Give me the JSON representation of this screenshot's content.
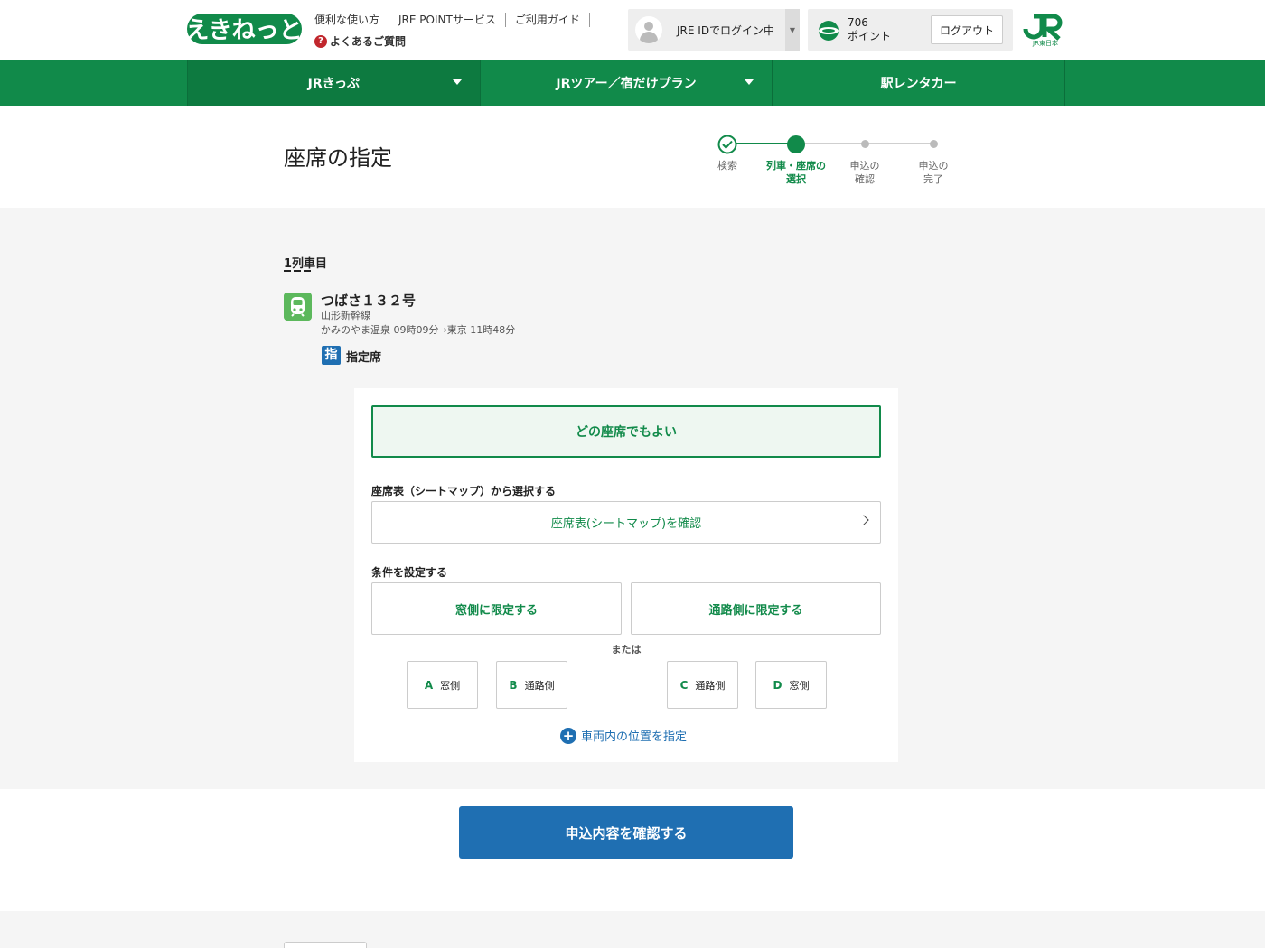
{
  "header": {
    "logo_text": "えきねっと",
    "top_links": [
      "便利な使い方",
      "JRE POINTサービス",
      "ご利用ガイド"
    ],
    "faq_label": "よくあるご質問",
    "login_status": "JRE IDでログイン中",
    "points_value": "706",
    "points_unit": "ポイント",
    "logout_label": "ログアウト",
    "jr_logo_caption": "JR東日本"
  },
  "nav": {
    "items": [
      {
        "label": "JRきっぷ"
      },
      {
        "label": "JRツアー／宿だけプラン"
      },
      {
        "label": "駅レンタカー"
      }
    ]
  },
  "page": {
    "title": "座席の指定",
    "steps": [
      {
        "label_line1": "検索",
        "label_line2": "",
        "state": "done"
      },
      {
        "label_line1": "列車・座席の",
        "label_line2": "選択",
        "state": "current"
      },
      {
        "label_line1": "申込の",
        "label_line2": "確認",
        "state": "todo"
      },
      {
        "label_line1": "申込の",
        "label_line2": "完了",
        "state": "todo"
      }
    ]
  },
  "train": {
    "section_label": "1列車目",
    "name": "つばさ１３２号",
    "line": "山形新幹線",
    "route": "かみのやま温泉 09時09分→東京 11時48分",
    "seat_badge": "指",
    "seat_type": "指定席"
  },
  "seat_selection": {
    "any_seat_label": "どの座席でもよい",
    "seatmap_heading": "座席表（シートマップ）から選択する",
    "seatmap_button": "座席表(シートマップ)を確認",
    "conditions_heading": "条件を設定する",
    "window_only": "窓側に限定する",
    "aisle_only": "通路側に限定する",
    "or_label": "または",
    "seats": [
      {
        "letter": "A",
        "label": "窓側"
      },
      {
        "letter": "B",
        "label": "通路側"
      },
      {
        "letter": "C",
        "label": "通路側"
      },
      {
        "letter": "D",
        "label": "窓側"
      }
    ],
    "position_link": "車両内の位置を指定"
  },
  "confirm_button": "申込内容を確認する",
  "colors": {
    "brand_green": "#118a4a",
    "action_blue": "#1f6fb2"
  }
}
